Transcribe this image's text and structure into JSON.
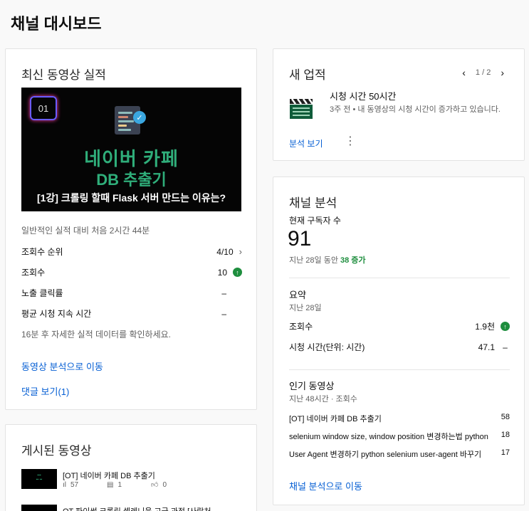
{
  "page": {
    "title": "채널 대시보드"
  },
  "latest_video": {
    "card_title": "최신 동영상 실적",
    "thumbnail": {
      "episode": "01",
      "headline_1": "네이버 카페",
      "headline_2": "DB 추출기",
      "caption": "[1강] 크롤링 할때 Flask 서버 만드는 이유는?"
    },
    "perf_note": "일반적인 실적 대비 처음 2시간 44분",
    "metrics": [
      {
        "label": "조회수 순위",
        "value": "4/10"
      },
      {
        "label": "조회수",
        "value": "10"
      },
      {
        "label": "노출 클릭률",
        "value": "–"
      },
      {
        "label": "평균 시청 지속 시간",
        "value": "–"
      }
    ],
    "sub_note": "16분 후 자세한 실적 데이터를 확인하세요.",
    "analytics_link": "동영상 분석으로 이동",
    "comments_link": "댓글 보기(1)"
  },
  "published": {
    "card_title": "게시된 동영상",
    "videos": [
      {
        "title": "[OT] 네이버 카페 DB 추출기",
        "views": "57",
        "comments": "1",
        "likes": "0"
      },
      {
        "title": "OT 파이썬 크롤링 셀레니움 고급 과정 [사람처"
      }
    ]
  },
  "achievements": {
    "card_title": "새 업적",
    "pager": "1 / 2",
    "title": "시청 시간 50시간",
    "description": "3주 전 • 내 동영상의 시청 시간이 증가하고 있습니다.",
    "link": "분석 보기"
  },
  "analytics": {
    "card_title": "채널 분석",
    "subs_label": "현재 구독자 수",
    "subs_count": "91",
    "subs_change_prefix": "지난 28일 동안",
    "subs_change": "38 증가",
    "summary": {
      "title": "요약",
      "period": "지난 28일",
      "rows": [
        {
          "label": "조회수",
          "value": "1.9천"
        },
        {
          "label": "시청 시간(단위: 시간)",
          "value": "47.1"
        }
      ],
      "watch_change": "–"
    },
    "popular": {
      "title": "인기 동영상",
      "period": "지난 48시간 · 조회수",
      "rows": [
        {
          "title": "[OT] 네이버 카페 DB 추출기",
          "value": "58"
        },
        {
          "title": "selenium window size, window position 변경하는법 python",
          "value": "18"
        },
        {
          "title": "User Agent 변경하기 python selenium user-agent 바꾸기",
          "value": "17"
        }
      ]
    },
    "link": "채널 분석으로 이동"
  },
  "colors": {
    "accent_link": "#065fd4",
    "positive": "#1e8e3e"
  },
  "icons": [
    "chevron-right-icon",
    "arrow-up-icon",
    "chevron-left-icon",
    "clapperboard-icon",
    "more-vert-icon",
    "views-icon",
    "comment-icon",
    "thumb-up-icon",
    "check-icon",
    "code-file-icon"
  ]
}
